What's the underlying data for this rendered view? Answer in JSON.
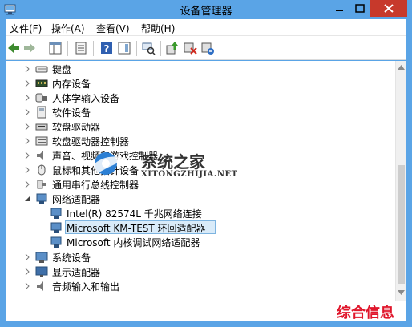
{
  "window": {
    "title": "设备管理器",
    "accent_color": "#5aa4e6",
    "close_color": "#c7392b"
  },
  "menu": {
    "items": [
      "文件(F)",
      "操作(A)",
      "查看(V)",
      "帮助(H)"
    ]
  },
  "toolbar": {
    "buttons": [
      "back-icon",
      "forward-icon",
      "show-hide-tree-icon",
      "properties-icon",
      "help-icon",
      "action-pane-icon",
      "scan-hardware-icon",
      "update-driver-icon",
      "disable-device-icon",
      "uninstall-device-icon"
    ]
  },
  "tree": {
    "items": [
      {
        "label": "键盘",
        "icon": "keyboard-icon",
        "state": "collapsed"
      },
      {
        "label": "内存设备",
        "icon": "memory-icon",
        "state": "collapsed"
      },
      {
        "label": "人体学输入设备",
        "icon": "hid-icon",
        "state": "collapsed"
      },
      {
        "label": "软件设备",
        "icon": "software-device-icon",
        "state": "collapsed"
      },
      {
        "label": "软盘驱动器",
        "icon": "floppy-drive-icon",
        "state": "collapsed"
      },
      {
        "label": "软盘驱动器控制器",
        "icon": "floppy-controller-icon",
        "state": "collapsed"
      },
      {
        "label": "声音、视频和游戏控制器",
        "icon": "sound-icon",
        "state": "collapsed"
      },
      {
        "label": "鼠标和其他指针设备",
        "icon": "mouse-icon",
        "state": "collapsed"
      },
      {
        "label": "通用串行总线控制器",
        "icon": "usb-icon",
        "state": "collapsed"
      },
      {
        "label": "网络适配器",
        "icon": "network-adapter-icon",
        "state": "expanded"
      },
      {
        "label": "Intel(R) 82574L 千兆网络连接",
        "icon": "network-adapter-icon",
        "state": "child"
      },
      {
        "label": "Microsoft KM-TEST 环回适配器",
        "icon": "network-adapter-icon",
        "state": "child-selected"
      },
      {
        "label": "Microsoft 内核调试网络适配器",
        "icon": "network-adapter-icon",
        "state": "child"
      },
      {
        "label": "系统设备",
        "icon": "system-device-icon",
        "state": "collapsed"
      },
      {
        "label": "显示适配器",
        "icon": "display-adapter-icon",
        "state": "collapsed"
      },
      {
        "label": "音频输入和输出",
        "icon": "audio-io-icon",
        "state": "collapsed"
      }
    ]
  },
  "watermark": {
    "title": "系统之家",
    "url": "XITONGZHIJIA.NET"
  },
  "stamp": {
    "text": "综合信息",
    "color": "#e0162b"
  }
}
